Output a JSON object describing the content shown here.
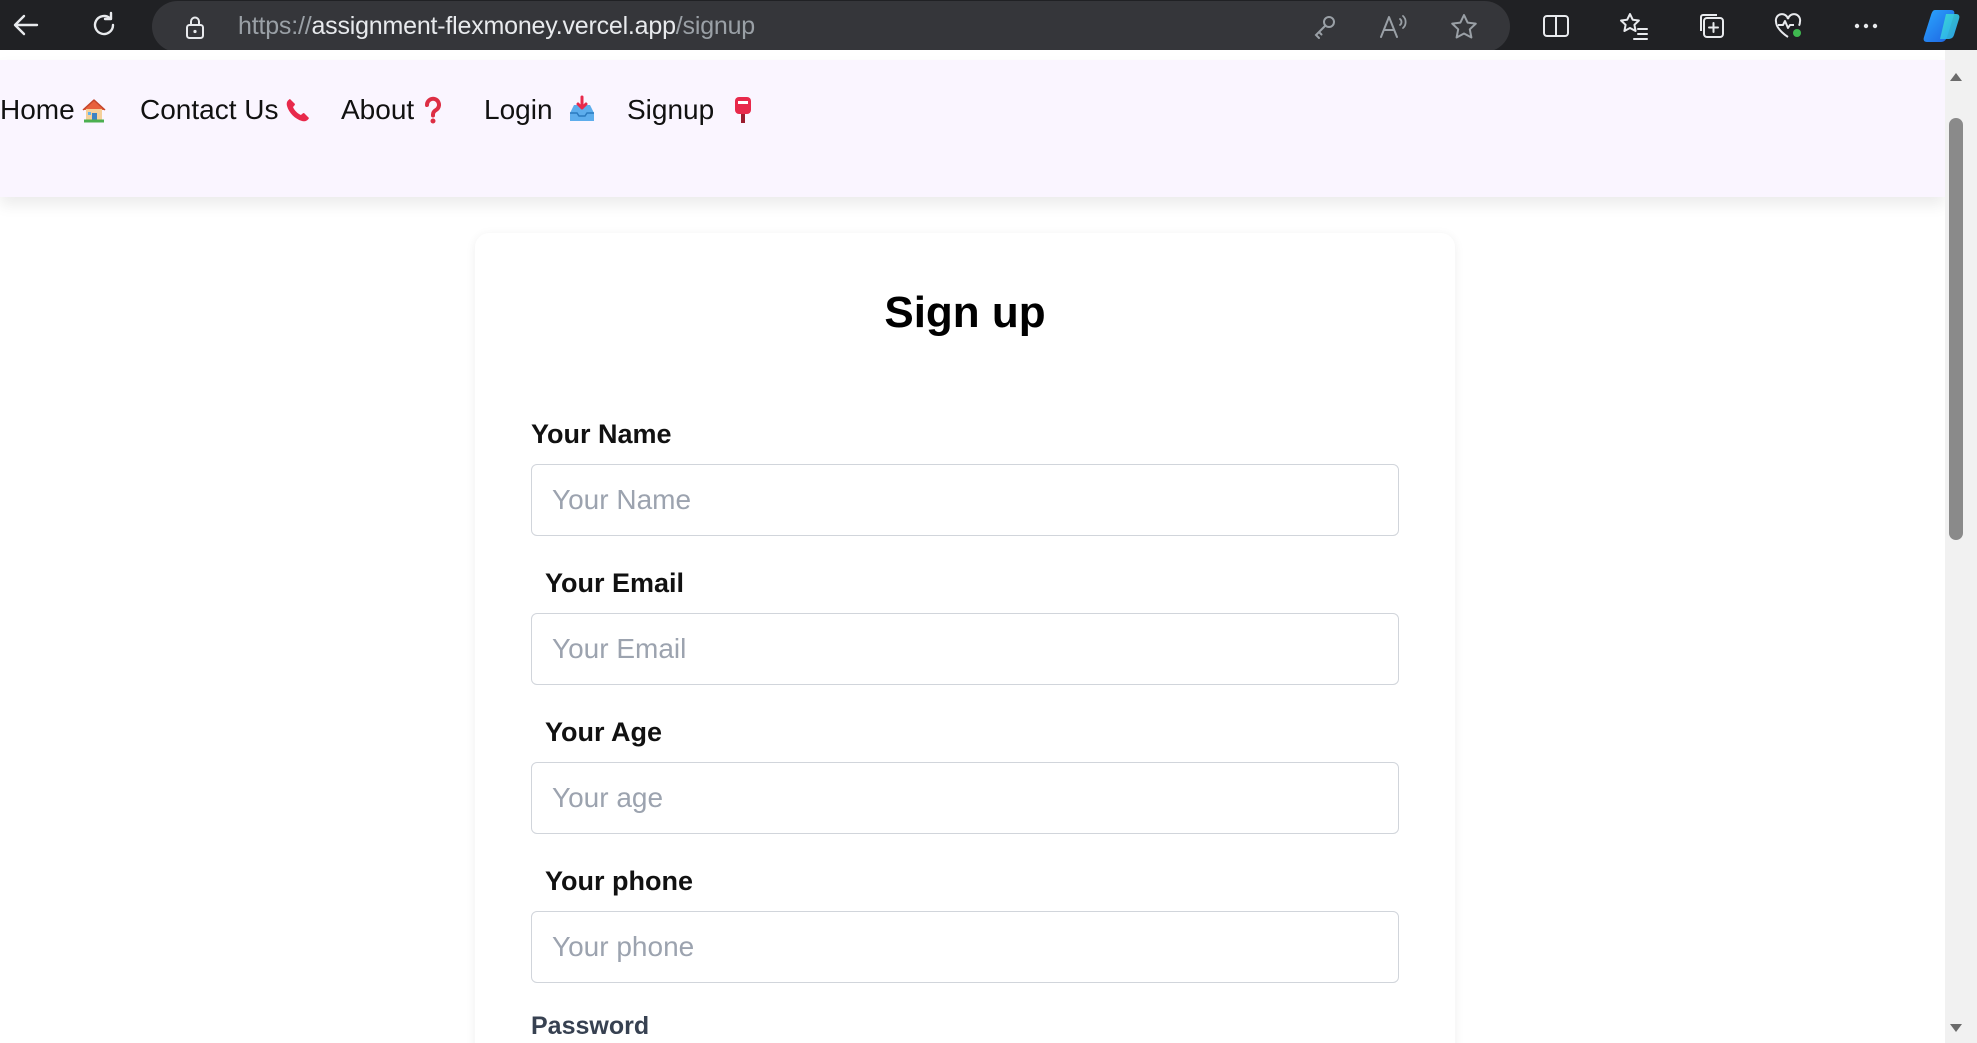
{
  "browser": {
    "url_scheme": "https://",
    "url_host": "assignment-flexmoney.vercel.app",
    "url_path": "/signup"
  },
  "nav": {
    "items": [
      {
        "label": "Home",
        "icon": "house-emoji"
      },
      {
        "label": "Contact Us",
        "icon": "telephone-receiver-emoji"
      },
      {
        "label": "About",
        "icon": "red-question-mark-emoji"
      },
      {
        "label": "Login",
        "icon": "inbox-tray-emoji"
      },
      {
        "label": "Signup",
        "icon": "postbox-emoji"
      }
    ]
  },
  "form": {
    "title": "Sign up",
    "fields": [
      {
        "label": "Your Name",
        "placeholder": "Your Name",
        "value": ""
      },
      {
        "label": "Your Email",
        "placeholder": "Your Email",
        "value": ""
      },
      {
        "label": "Your Age",
        "placeholder": "Your age",
        "value": ""
      },
      {
        "label": "Your phone",
        "placeholder": "Your phone",
        "value": ""
      }
    ],
    "password_label": "Password"
  },
  "colors": {
    "nav_background": "#faf5ff",
    "browser_chrome": "#202124",
    "input_border": "#d1d5db",
    "placeholder": "#9ca3af"
  }
}
